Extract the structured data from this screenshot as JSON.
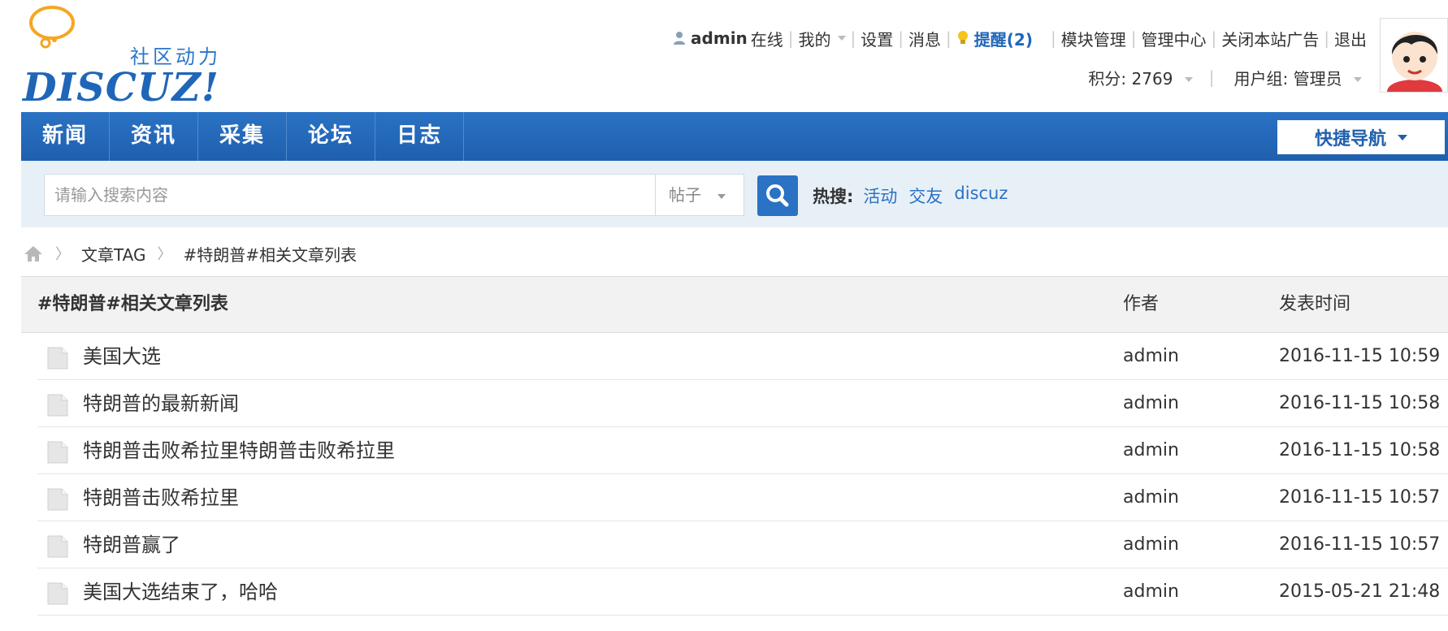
{
  "logo": {
    "subtitle": "社区动力",
    "title": "DISCUZ!"
  },
  "topbar": {
    "username": "admin",
    "status": "在线",
    "my": "我的",
    "settings": "设置",
    "messages": "消息",
    "reminder": "提醒(2)",
    "module_manage": "模块管理",
    "admin_center": "管理中心",
    "close_ads": "关闭本站广告",
    "logout": "退出",
    "points": "积分: 2769",
    "user_group": "用户组: 管理员"
  },
  "nav": {
    "items": [
      {
        "label": "新闻"
      },
      {
        "label": "资讯"
      },
      {
        "label": "采集"
      },
      {
        "label": "论坛"
      },
      {
        "label": "日志"
      }
    ],
    "quick_nav": "快捷导航"
  },
  "search": {
    "placeholder": "请输入搜索内容",
    "type": "帖子",
    "hot_label": "热搜:",
    "hot_terms": [
      "活动",
      "交友",
      "discuz"
    ]
  },
  "breadcrumb": {
    "items": [
      "文章TAG",
      "#特朗普#相关文章列表"
    ]
  },
  "table": {
    "headers": {
      "title": "#特朗普#相关文章列表",
      "author": "作者",
      "time": "发表时间"
    },
    "rows": [
      {
        "title": "美国大选",
        "author": "admin",
        "time": "2016-11-15 10:59"
      },
      {
        "title": "特朗普的最新新闻",
        "author": "admin",
        "time": "2016-11-15 10:58"
      },
      {
        "title": "特朗普击败希拉里特朗普击败希拉里",
        "author": "admin",
        "time": "2016-11-15 10:58"
      },
      {
        "title": "特朗普击败希拉里",
        "author": "admin",
        "time": "2016-11-15 10:57"
      },
      {
        "title": "特朗普赢了",
        "author": "admin",
        "time": "2016-11-15 10:57"
      },
      {
        "title": "美国大选结束了，哈哈",
        "author": "admin",
        "time": "2015-05-21 21:48"
      }
    ]
  },
  "colors": {
    "brand_blue": "#1f60ae",
    "link_blue": "#2a72c4",
    "search_bg": "#e8f0f7"
  }
}
